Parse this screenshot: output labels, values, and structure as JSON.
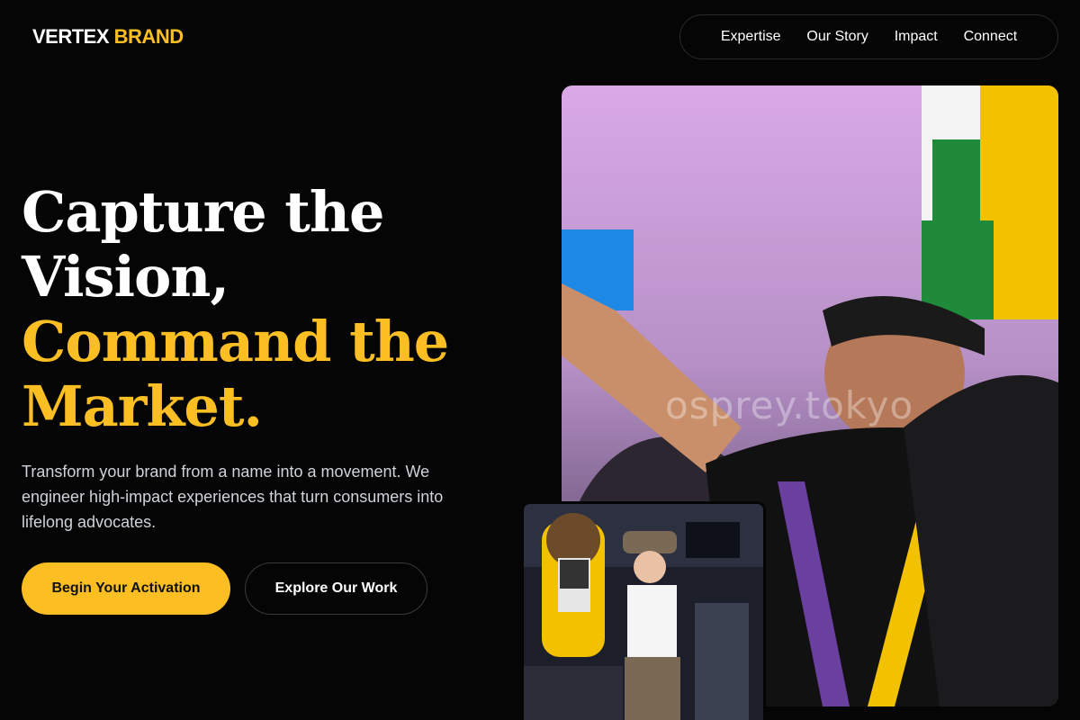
{
  "brand": {
    "name_part1": "VERTEX",
    "name_part2": "BRAND",
    "accent_color": "#fbbf24"
  },
  "nav": {
    "items": [
      {
        "label": "Expertise"
      },
      {
        "label": "Our Story"
      },
      {
        "label": "Impact"
      },
      {
        "label": "Connect"
      }
    ]
  },
  "hero": {
    "title_line1": "Capture the",
    "title_line2": "Vision,",
    "title_line3": "Command the",
    "title_line4": "Market.",
    "subtitle": "Transform your brand from a name into a movement. We engineer high-impact experiences that turn consumers into lifelong advocates.",
    "primary_cta": "Begin Your Activation",
    "secondary_cta": "Explore Our Work"
  },
  "images": {
    "main_photo": {
      "watermark": "osprey.tokyo"
    },
    "small_photo": {}
  }
}
